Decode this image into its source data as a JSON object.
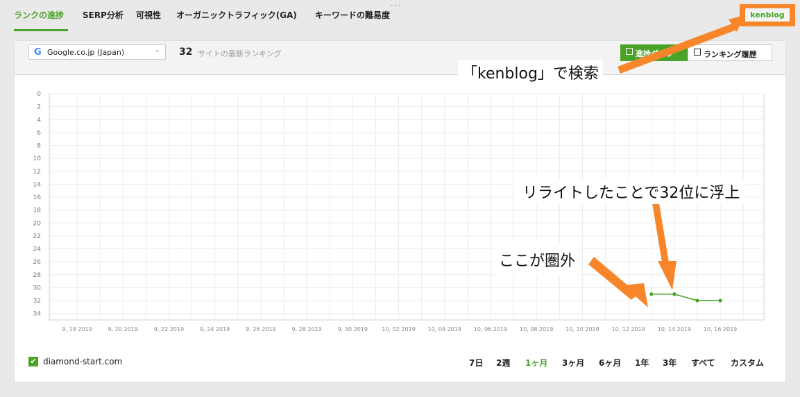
{
  "nav": {
    "items": [
      "ランクの進捗",
      "SERP分析",
      "可視性",
      "オーガニックトラフィック(GA)",
      "キーワードの難易度"
    ],
    "brand": "kenblog"
  },
  "toolbar": {
    "engine": "Google.co.jp (Japan)",
    "engine_icon": "google-g-icon",
    "count": "32",
    "count_label": "サイトの最新ランキング",
    "view_graph": "進捗グラフ",
    "view_table": "ランキング履歴"
  },
  "annotations": {
    "search": "「kenblog」で検索",
    "rewrite": "リライトしたことで32位に浮上",
    "out": "ここが圏外"
  },
  "chart_data": {
    "type": "line",
    "y_ticks": [
      "0",
      "2",
      "4",
      "6",
      "8",
      "10",
      "12",
      "14",
      "16",
      "18",
      "20",
      "22",
      "24",
      "26",
      "28",
      "30",
      "32",
      "34"
    ],
    "ylim": [
      0,
      35
    ],
    "y_inverted": true,
    "x_ticks": [
      "9, 18 2019",
      "9, 20 2019",
      "9, 22 2019",
      "9, 24 2019",
      "9, 26 2019",
      "9, 28 2019",
      "9, 30 2019",
      "10, 02 2019",
      "10, 04 2019",
      "10, 06 2019",
      "10, 08 2019",
      "10, 10 2019",
      "10, 12 2019",
      "10, 14 2019",
      "10, 16 2019"
    ],
    "grid": true,
    "series": [
      {
        "color": "#4aa329",
        "points": [
          {
            "x": "10, 13 2019",
            "y": 31
          },
          {
            "x": "10, 14 2019",
            "y": 31
          },
          {
            "x": "10, 15 2019",
            "y": 32
          },
          {
            "x": "10, 16 2019",
            "y": 32
          }
        ]
      }
    ]
  },
  "footer": {
    "site": "diamond-start.com",
    "ranges": [
      "7日",
      "2週",
      "1ヶ月",
      "3ヶ月",
      "6ヶ月",
      "1年",
      "3年",
      "すべて",
      "カスタム"
    ],
    "active_range": "1ヶ月"
  },
  "colors": {
    "accent": "#4aa329",
    "highlight": "#f7862a"
  }
}
